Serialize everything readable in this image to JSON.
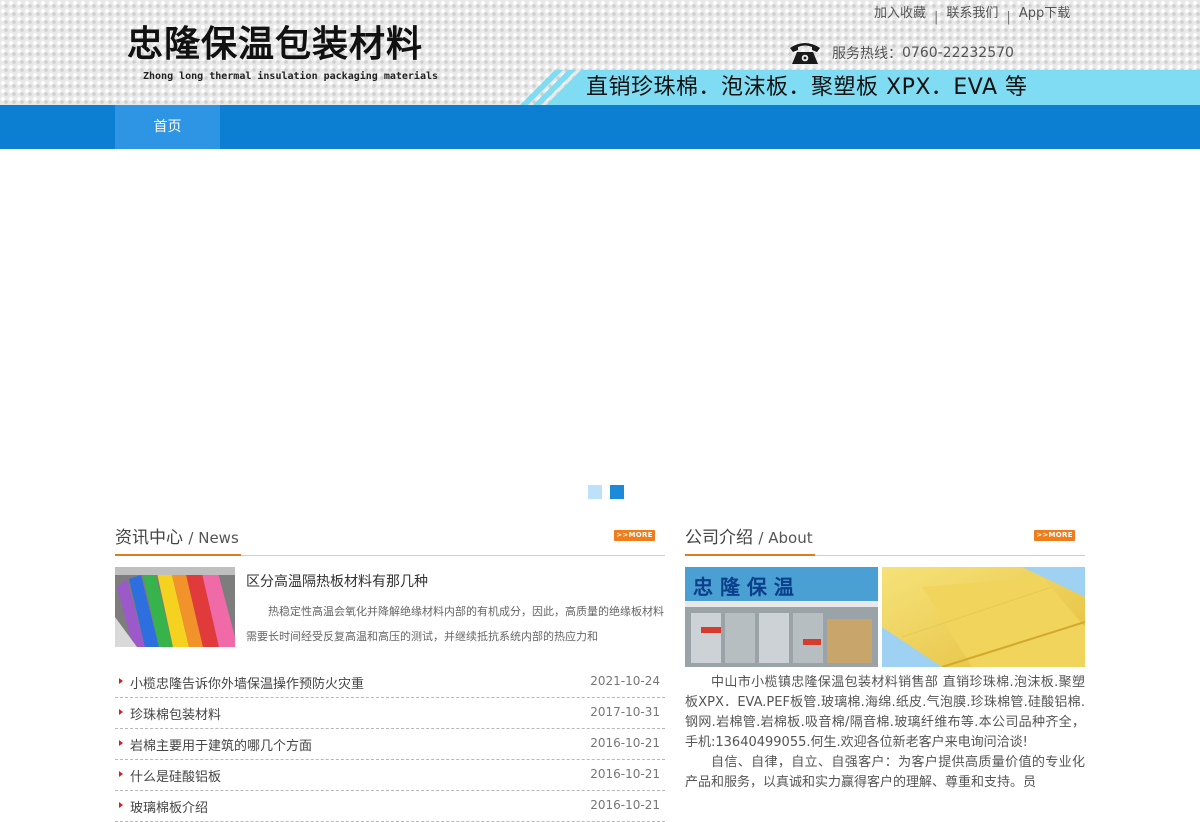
{
  "header": {
    "logo_title": "忠隆保温包装材料",
    "logo_subtitle": "Zhong long thermal insulation packaging materials",
    "top_links": [
      "加入收藏",
      "联系我们",
      "App下载"
    ],
    "hotline_label": "服务热线：",
    "hotline_number": "0760-22232570",
    "slogan": "直销珍珠棉．泡沫板．聚塑板 XPX．EVA 等"
  },
  "nav": {
    "items": [
      "首页"
    ]
  },
  "banner": {
    "dots": 2,
    "active_dot": 2
  },
  "news": {
    "title": "资讯中心",
    "title_en": "/ News",
    "more_label": ">>MORE",
    "featured": {
      "title": "区分高温隔热板材料有那几种",
      "desc": "热稳定性高温会氧化并降解绝缘材料内部的有机成分，因此，高质量的绝缘板材料需要长时间经受反复高温和高压的测试，并继续抵抗系统内部的热应力和"
    },
    "items": [
      {
        "title": "小榄忠隆告诉你外墙保温操作预防火灾重",
        "date": "2021-10-24"
      },
      {
        "title": "珍珠棉包装材料",
        "date": "2017-10-31"
      },
      {
        "title": "岩棉主要用于建筑的哪几个方面",
        "date": "2016-10-21"
      },
      {
        "title": "什么是硅酸铝板",
        "date": "2016-10-21"
      },
      {
        "title": "玻璃棉板介绍",
        "date": "2016-10-21"
      }
    ]
  },
  "about": {
    "title": "公司介绍",
    "title_en": "/ About",
    "more_label": ">>MORE",
    "store_sign": "忠 隆 保 温",
    "paragraphs": [
      "中山市小榄镇忠隆保温包装材料销售部  直销珍珠棉.泡沫板.聚塑板XPX．EVA.PEF板管.玻璃棉.海绵.纸皮.气泡膜.珍珠棉管.硅酸铝棉.钢网.岩棉管.岩棉板.吸音棉/隔音棉.玻璃纤维布等.本公司品种齐全，手机:13640499055.何生.欢迎各位新老客户来电询问洽谈!",
      "自信、自律，自立、自强客户：为客户提供高质量价值的专业化产品和服务，以真诚和实力赢得客户的理解、尊重和支持。员"
    ]
  },
  "colors": {
    "nav_blue": "#0c7fd2",
    "nav_active": "#2d95e4",
    "stripe_cyan": "#7fdcf2",
    "accent_orange": "#e07b1e",
    "bullet_red": "#d61f1f"
  }
}
